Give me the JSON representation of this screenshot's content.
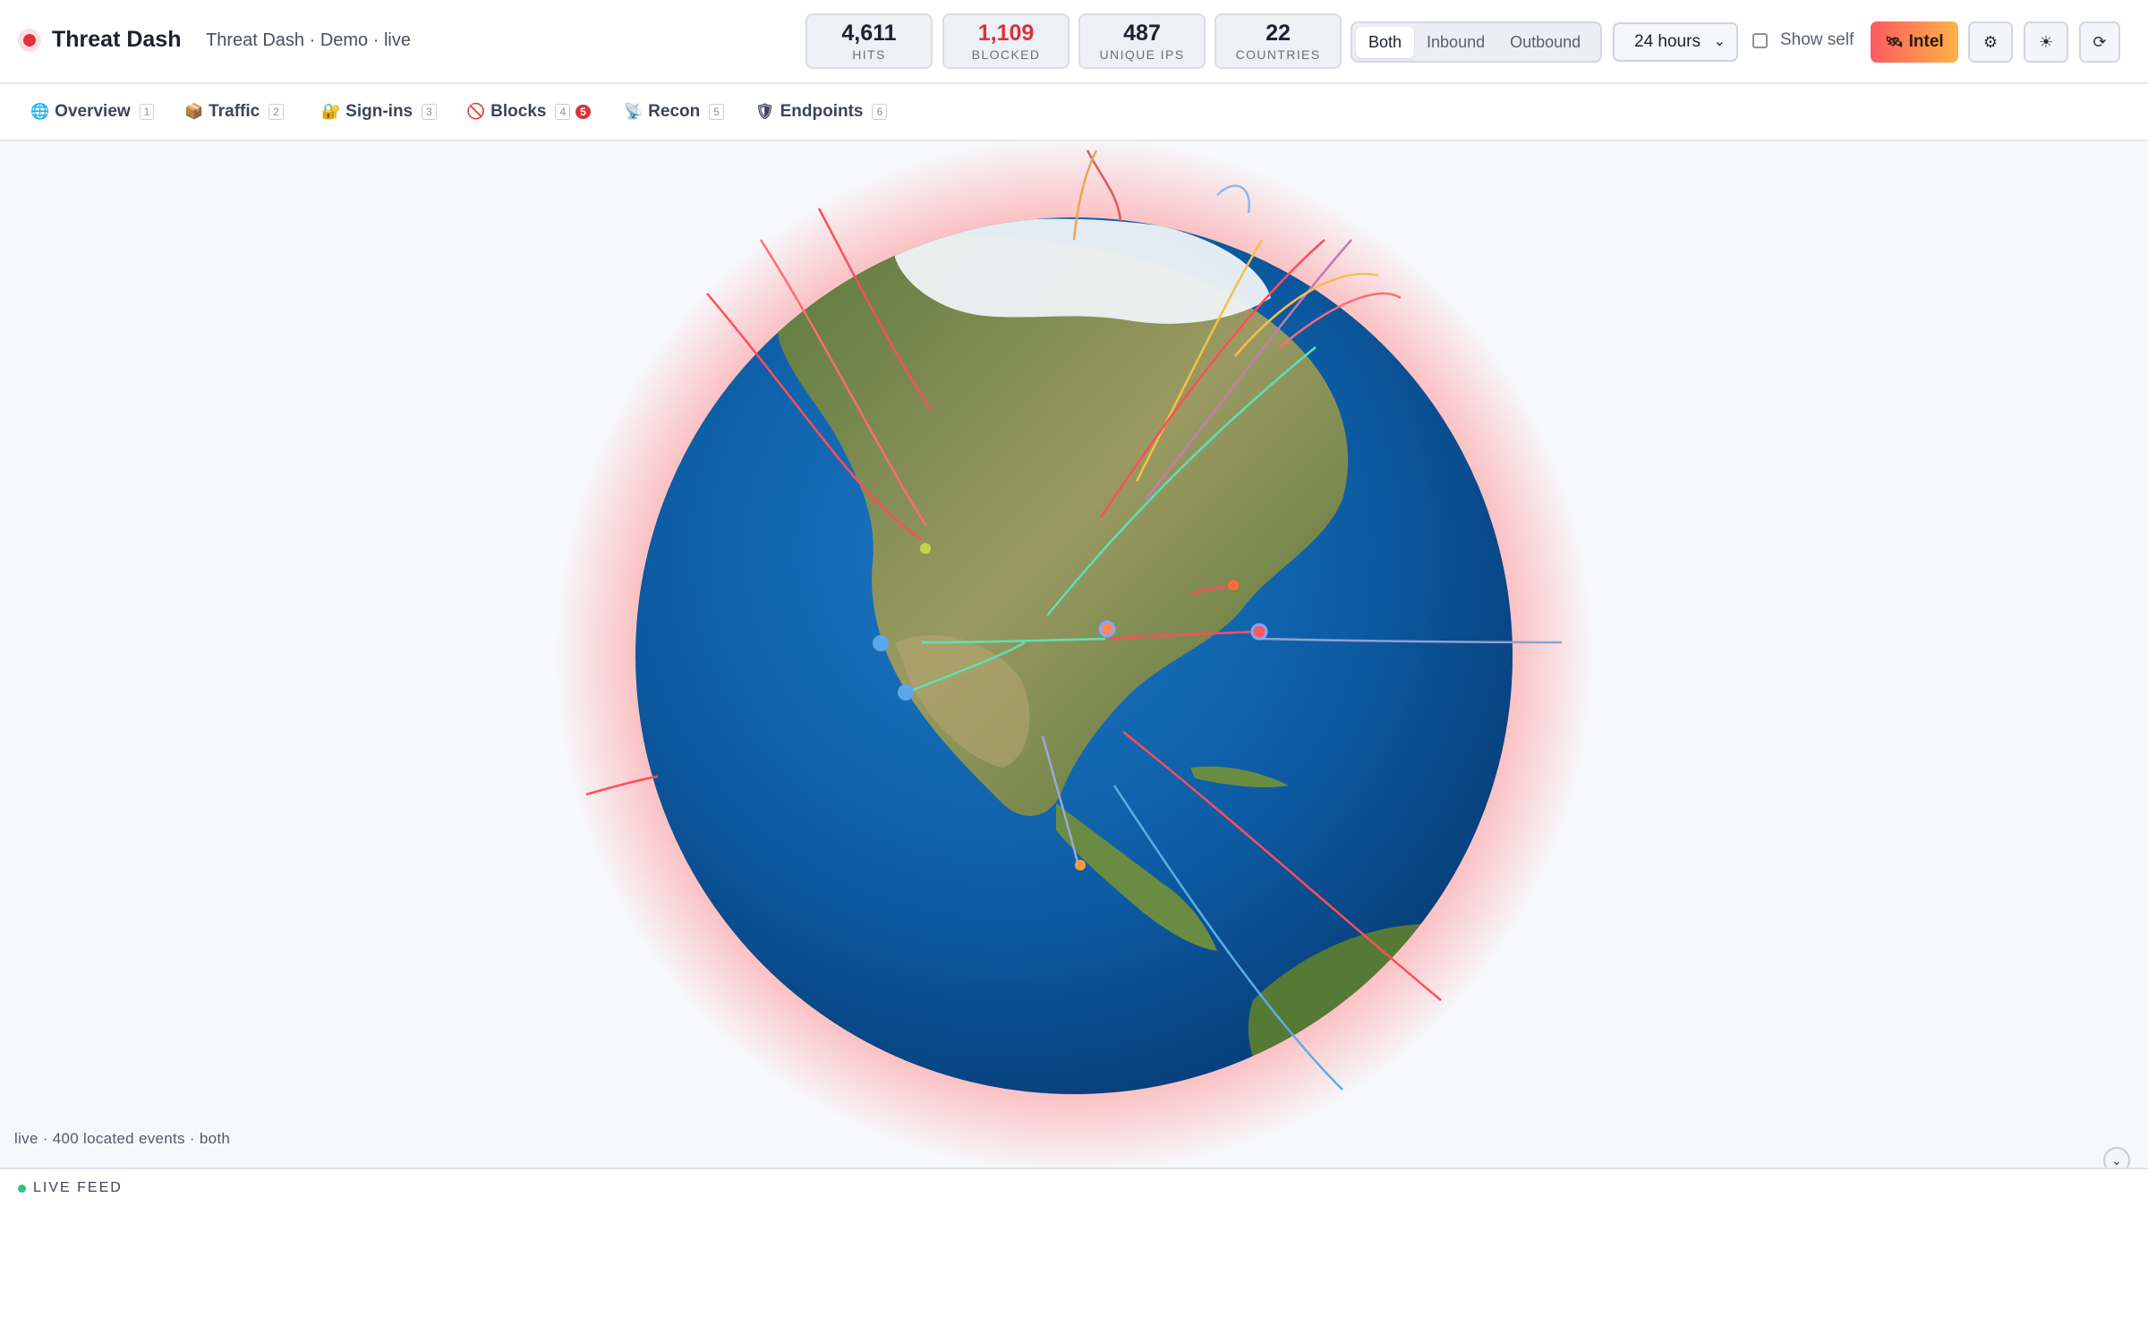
{
  "header": {
    "title": "Threat Dash",
    "subtitle": "Threat Dash · Demo · live",
    "stats": [
      {
        "value": "4,611",
        "label": "HITS"
      },
      {
        "value": "1,109",
        "label": "BLOCKED"
      },
      {
        "value": "487",
        "label": "UNIQUE IPS"
      },
      {
        "value": "22",
        "label": "COUNTRIES"
      }
    ],
    "direction": {
      "options": [
        "Both",
        "Inbound",
        "Outbound"
      ],
      "selected": "Both"
    },
    "range": {
      "selected": "24 hours"
    },
    "show_self_label": "Show self",
    "intel_label": "Intel",
    "icons": {
      "intel": "satellite-icon",
      "settings": "gear-icon",
      "theme": "sun-icon",
      "refresh": "refresh-icon"
    }
  },
  "tabs": [
    {
      "icon": "🌐",
      "label": "Overview",
      "key": "1"
    },
    {
      "icon": "📦",
      "label": "Traffic",
      "key": "2"
    },
    {
      "icon": "🔐",
      "label": "Sign-ins",
      "key": "3"
    },
    {
      "icon": "🚫",
      "label": "Blocks",
      "key": "4",
      "badge": "5"
    },
    {
      "icon": "📡",
      "label": "Recon",
      "key": "5"
    },
    {
      "icon": "🛡",
      "label": "Endpoints",
      "key": "6"
    }
  ],
  "globe": {
    "status": "live · 400 located events · both",
    "colors": {
      "ocean": "#0d5da6",
      "land": "#6f8f4a",
      "glow": "#ff6b6b",
      "inbound": "#ff4d5a",
      "outbound": "#5fe0b5"
    }
  },
  "feed": {
    "title": "LIVE FEED"
  }
}
